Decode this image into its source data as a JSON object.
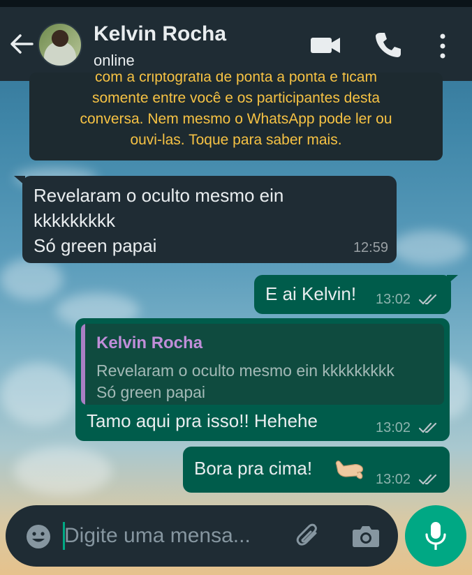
{
  "header": {
    "contact_name": "Kelvin Rocha",
    "status": "online"
  },
  "system_notice": {
    "lines": [
      "com a criptografia de ponta a ponta e ficam",
      "somente entre você e os participantes desta",
      "conversa. Nem mesmo o WhatsApp pode ler ou",
      "ouvi-las. Toque para saber mais."
    ]
  },
  "messages": [
    {
      "direction": "incoming",
      "lines": [
        "Revelaram o oculto mesmo ein",
        "kkkkkkkkk",
        "Só green papai"
      ],
      "time": "12:59"
    },
    {
      "direction": "outgoing",
      "text": "E ai Kelvin!",
      "time": "13:02",
      "read": true
    },
    {
      "direction": "outgoing",
      "reply_to": {
        "author": "Kelvin Rocha",
        "lines": [
          "Revelaram o oculto mesmo ein kkkkkkkkk",
          "Só green papai"
        ]
      },
      "text": "Tamo aqui pra isso!! Hehehe",
      "time": "13:02",
      "read": true
    },
    {
      "direction": "outgoing",
      "text": "Bora pra cima!",
      "emoji": "call-me-hand",
      "time": "13:02",
      "read": true
    }
  ],
  "composer": {
    "placeholder": "Digite uma mensa..."
  },
  "colors": {
    "header_bg": "#1f2c34",
    "incoming_bubble": "#1f2c34",
    "outgoing_bubble": "#005c4b",
    "accent": "#00a884",
    "notice_text": "#f6c244",
    "quote_author": "#c08ed9",
    "read_ticks": "#53bdeb"
  },
  "icons": [
    "back-arrow-icon",
    "video-call-icon",
    "phone-icon",
    "more-options-icon",
    "emoji-icon",
    "attach-icon",
    "camera-icon",
    "mic-icon"
  ]
}
